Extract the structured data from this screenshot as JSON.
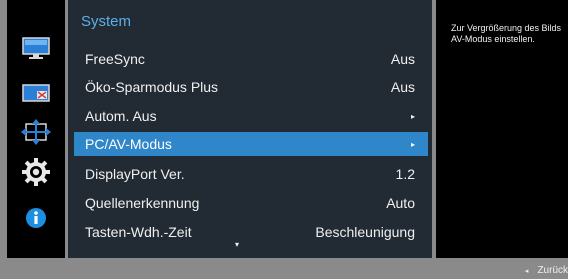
{
  "menu": {
    "title": "System",
    "items": [
      {
        "label": "FreeSync",
        "value": "Aus"
      },
      {
        "label": "Öko-Sparmodus Plus",
        "value": "Aus"
      },
      {
        "label": "Autom. Aus",
        "value": "▸"
      },
      {
        "label": "PC/AV-Modus",
        "value": "▸"
      },
      {
        "label": "DisplayPort Ver.",
        "value": "1.2"
      },
      {
        "label": "Quellenerkennung",
        "value": "Auto"
      },
      {
        "label": "Tasten-Wdh.-Zeit",
        "value": "Beschleunigung"
      }
    ],
    "selected_label": "PC/AV-Modus",
    "scroll_indicator": "▾"
  },
  "icons": [
    "picture-icon",
    "onscreen-display-icon",
    "position-size-icon",
    "system-gear-icon",
    "info-icon"
  ],
  "help": {
    "text": "Zur Vergrößerung des Bilds AV-Modus einstellen."
  },
  "footer": {
    "back_arrow": "◂",
    "back_label": "Zurück"
  },
  "colors": {
    "title": "#5ab0ea",
    "selection": "#2f86c8",
    "panel": "#222a33",
    "info": "#1d8fe0"
  }
}
